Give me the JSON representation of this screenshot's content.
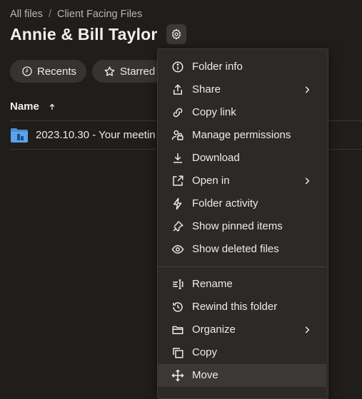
{
  "breadcrumb": {
    "root": "All files",
    "separator": "/",
    "current": "Client Facing Files"
  },
  "header": {
    "title": "Annie & Bill Taylor"
  },
  "filters": {
    "recents": "Recents",
    "starred": "Starred"
  },
  "table": {
    "name_header": "Name",
    "sort_icon": "arrow-up-icon"
  },
  "files": [
    {
      "name": "2023.10.30 - Your meetin",
      "icon": "shared-folder-icon"
    }
  ],
  "context_menu": {
    "items": [
      {
        "label": "Folder info",
        "icon": "info-icon"
      },
      {
        "label": "Share",
        "icon": "share-icon",
        "submenu": true
      },
      {
        "label": "Copy link",
        "icon": "link-icon"
      },
      {
        "label": "Manage permissions",
        "icon": "permissions-icon"
      },
      {
        "label": "Download",
        "icon": "download-icon"
      },
      {
        "label": "Open in",
        "icon": "open-in-icon",
        "submenu": true
      },
      {
        "label": "Folder activity",
        "icon": "activity-icon"
      },
      {
        "label": "Show pinned items",
        "icon": "pin-icon"
      },
      {
        "label": "Show deleted files",
        "icon": "eye-icon"
      },
      {
        "label": "Rename",
        "icon": "rename-icon"
      },
      {
        "label": "Rewind this folder",
        "icon": "rewind-icon"
      },
      {
        "label": "Organize",
        "icon": "organize-icon",
        "submenu": true
      },
      {
        "label": "Copy",
        "icon": "copy-icon"
      },
      {
        "label": "Move",
        "icon": "move-icon",
        "highlighted": true
      }
    ]
  },
  "colors": {
    "background": "#1f1e1c",
    "menu": "#2b2a28",
    "highlight": "#3a3936",
    "folder": "#4a90d9"
  }
}
